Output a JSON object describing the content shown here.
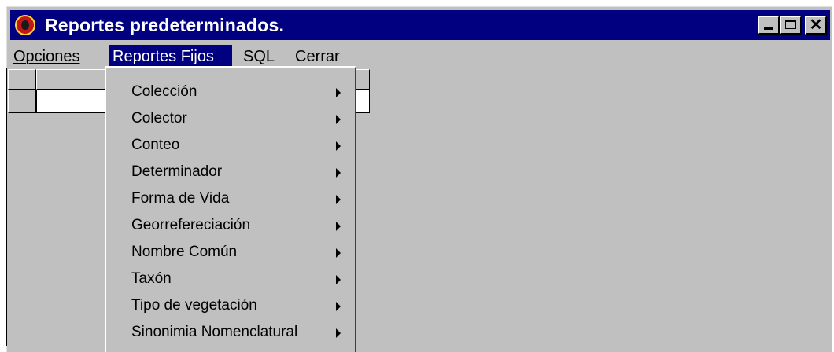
{
  "window": {
    "title": "Reportes predeterminados.",
    "close_glyph": "✕"
  },
  "menubar": {
    "items": [
      {
        "label": "Opciones"
      },
      {
        "label": "Reportes Fijos"
      },
      {
        "label": "SQL"
      },
      {
        "label": "Cerrar"
      }
    ]
  },
  "dropdown": {
    "items": [
      {
        "label": "Colección"
      },
      {
        "label": "Colector"
      },
      {
        "label": "Conteo"
      },
      {
        "label": "Determinador"
      },
      {
        "label": "Forma de Vida"
      },
      {
        "label": "Georrefereciación"
      },
      {
        "label": "Nombre Común"
      },
      {
        "label": "Taxón"
      },
      {
        "label": "Tipo de vegetación"
      },
      {
        "label": "Sinonimia Nomenclatural"
      }
    ]
  },
  "icons": {
    "app": "ladybug-app-icon",
    "submenu_arrow": "submenu-arrow-icon"
  },
  "colors": {
    "titlebar": "#000080",
    "face": "#c0c0c0",
    "highlight": "#000080"
  }
}
